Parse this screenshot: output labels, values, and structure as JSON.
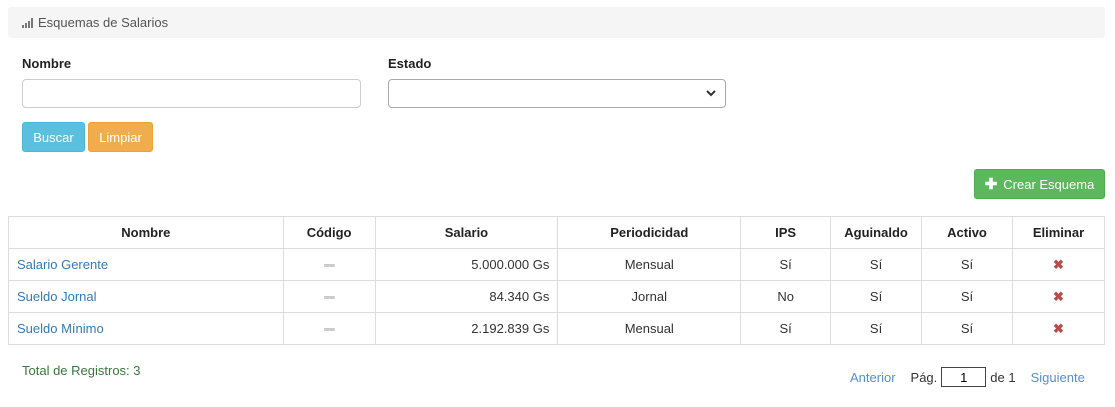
{
  "header": {
    "title": "Esquemas de Salarios",
    "icon": "signal-bars-icon"
  },
  "filters": {
    "nombre_label": "Nombre",
    "nombre_value": "",
    "estado_label": "Estado",
    "estado_value": ""
  },
  "buttons": {
    "buscar": "Buscar",
    "limpiar": "Limpiar",
    "crear": "Crear Esquema"
  },
  "table": {
    "headers": [
      "Nombre",
      "Código",
      "Salario",
      "Periodicidad",
      "IPS",
      "Aguinaldo",
      "Activo",
      "Eliminar"
    ],
    "rows": [
      {
        "nombre": "Salario Gerente",
        "codigo": "",
        "salario": "5.000.000 Gs",
        "periodicidad": "Mensual",
        "ips": "Sí",
        "aguinaldo": "Sí",
        "activo": "Sí"
      },
      {
        "nombre": "Sueldo Jornal",
        "codigo": "",
        "salario": "84.340 Gs",
        "periodicidad": "Jornal",
        "ips": "No",
        "aguinaldo": "Sí",
        "activo": "Sí"
      },
      {
        "nombre": "Sueldo Mínimo",
        "codigo": "",
        "salario": "2.192.839 Gs",
        "periodicidad": "Mensual",
        "ips": "Sí",
        "aguinaldo": "Sí",
        "activo": "Sí"
      }
    ]
  },
  "footer": {
    "total_label": "Total de Registros: 3",
    "anterior": "Anterior",
    "pag_label": "Pág.",
    "page_value": "1",
    "of_label": "de 1",
    "siguiente": "Siguiente"
  },
  "colors": {
    "info": "#5bc0de",
    "warning": "#f0ad4e",
    "success": "#5cb85c",
    "link": "#337ab7",
    "danger": "#b94a48"
  }
}
